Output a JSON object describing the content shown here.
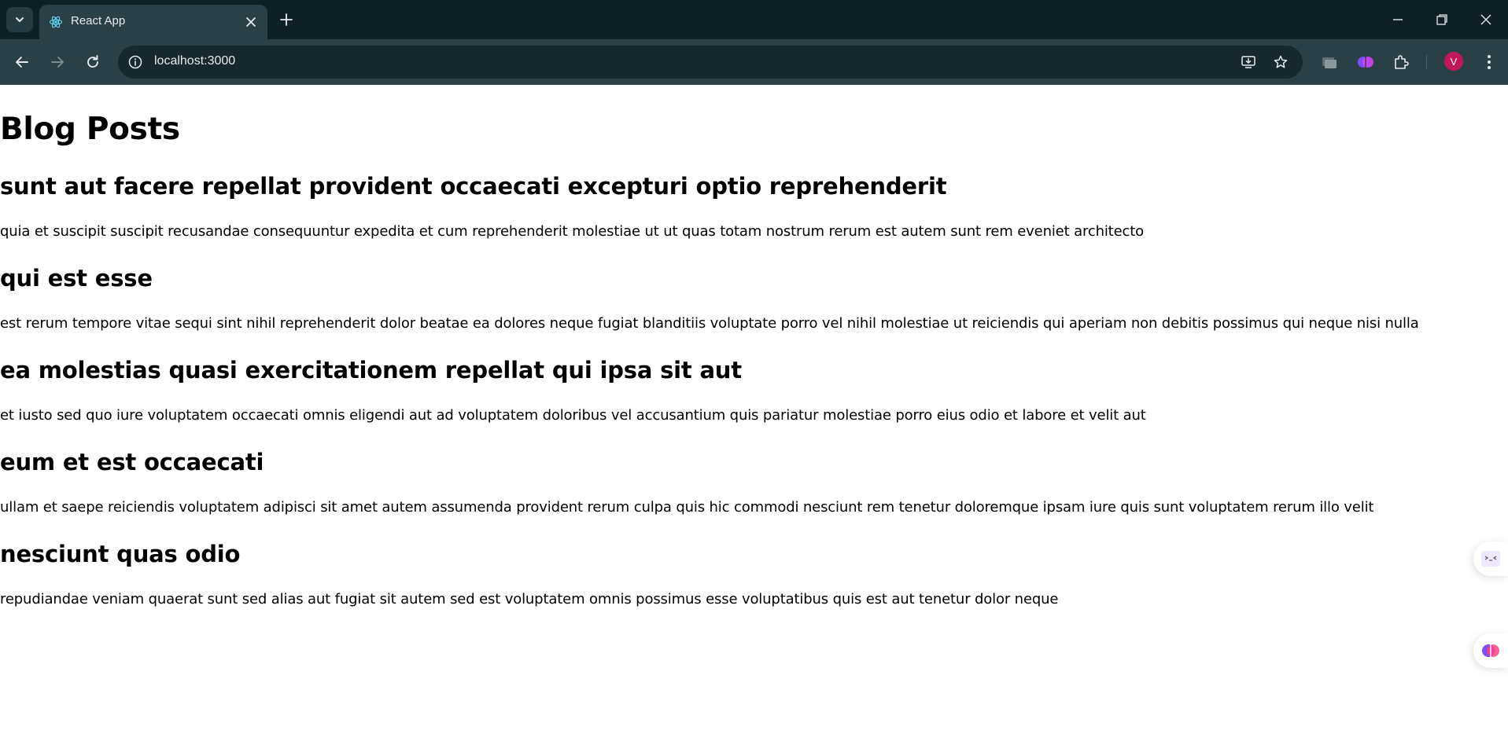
{
  "browser": {
    "tab_title": "React App",
    "url": "localhost:3000",
    "profile_initial": "V"
  },
  "page": {
    "heading": "Blog Posts",
    "posts": [
      {
        "title": "sunt aut facere repellat provident occaecati excepturi optio reprehenderit",
        "body": "quia et suscipit suscipit recusandae consequuntur expedita et cum reprehenderit molestiae ut ut quas totam nostrum rerum est autem sunt rem eveniet architecto"
      },
      {
        "title": "qui est esse",
        "body": "est rerum tempore vitae sequi sint nihil reprehenderit dolor beatae ea dolores neque fugiat blanditiis voluptate porro vel nihil molestiae ut reiciendis qui aperiam non debitis possimus qui neque nisi nulla"
      },
      {
        "title": "ea molestias quasi exercitationem repellat qui ipsa sit aut",
        "body": "et iusto sed quo iure voluptatem occaecati omnis eligendi aut ad voluptatem doloribus vel accusantium quis pariatur molestiae porro eius odio et labore et velit aut"
      },
      {
        "title": "eum et est occaecati",
        "body": "ullam et saepe reiciendis voluptatem adipisci sit amet autem assumenda provident rerum culpa quis hic commodi nesciunt rem tenetur doloremque ipsam iure quis sunt voluptatem rerum illo velit"
      },
      {
        "title": "nesciunt quas odio",
        "body": "repudiandae veniam quaerat sunt sed alias aut fugiat sit autem sed est voluptatem omnis possimus esse voluptatibus quis est aut tenetur dolor neque"
      }
    ]
  },
  "colors": {
    "tabbar_bg": "#0f1f26",
    "toolbar_bg": "#2b3f46",
    "avatar_bg": "#c2185b"
  }
}
